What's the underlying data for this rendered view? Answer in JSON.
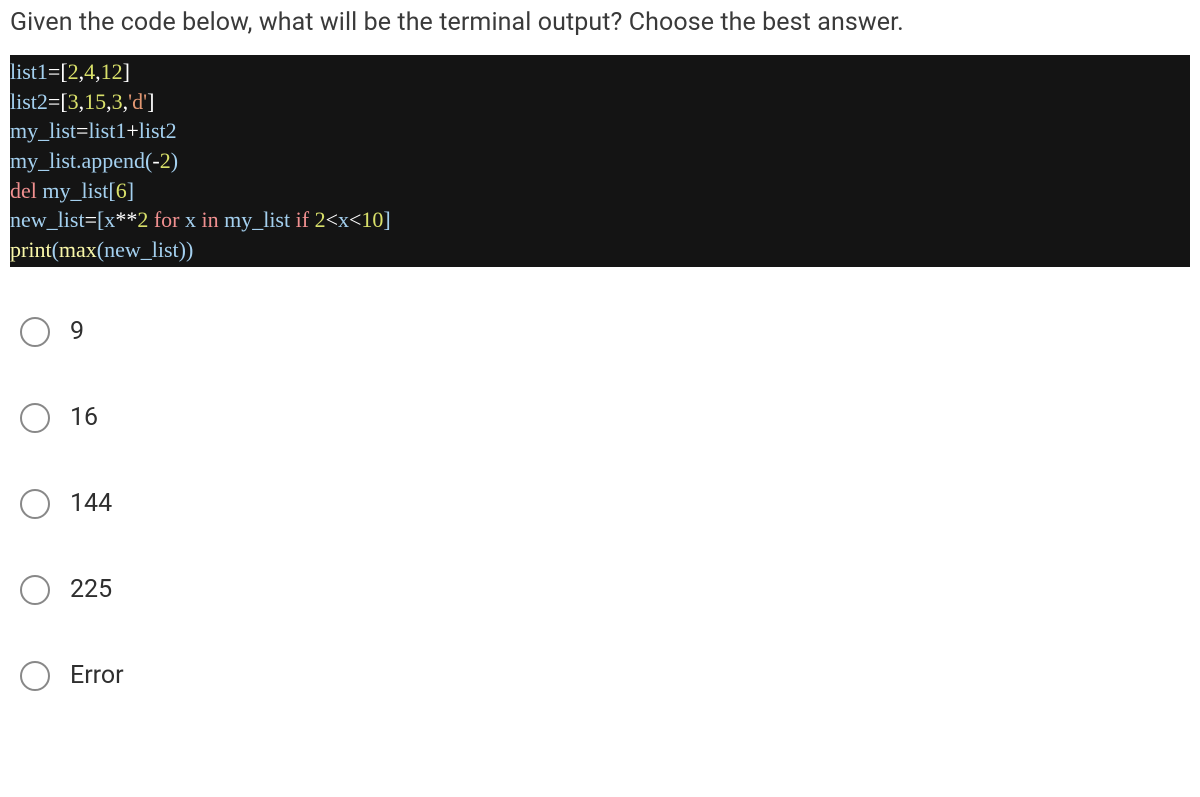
{
  "question": "Given the code below, what will be the terminal output? Choose the best answer.",
  "code": {
    "l1": {
      "a": "list1",
      "b": "=",
      "c": "[",
      "d": "2",
      "e": ",",
      "f": "4",
      "g": ",",
      "h": "12",
      "i": "]"
    },
    "l2": {
      "a": "list2",
      "b": "=",
      "c": "[",
      "d": "3",
      "e": ",",
      "f": "15",
      "g": ",",
      "h": "3",
      "i": ",",
      "j": "'d'",
      "k": "]"
    },
    "l3": {
      "a": "my_list",
      "b": "=",
      "c": "list1",
      "d": "+",
      "e": "list2"
    },
    "l4": {
      "a": "my_list.append(",
      "b": "-",
      "c": "2",
      "d": ")"
    },
    "l5": {
      "a": "del",
      "b": " my_list[",
      "c": "6",
      "d": "]"
    },
    "l6": {
      "a": "new_list",
      "b": "=",
      "c": "[x",
      "d": "**",
      "e": "2",
      "f": " ",
      "g": "for",
      "h": " x ",
      "i": "in",
      "j": " my_list ",
      "k": "if",
      "l": " ",
      "m": "2",
      "n": "<",
      "o": "x",
      "p": "<",
      "q": "10",
      "r": "]"
    },
    "l7": {
      "a": "print",
      "b": "(",
      "c": "max",
      "d": "(new_list))"
    }
  },
  "options": [
    {
      "label": "9"
    },
    {
      "label": "16"
    },
    {
      "label": "144"
    },
    {
      "label": "225"
    },
    {
      "label": "Error"
    }
  ]
}
